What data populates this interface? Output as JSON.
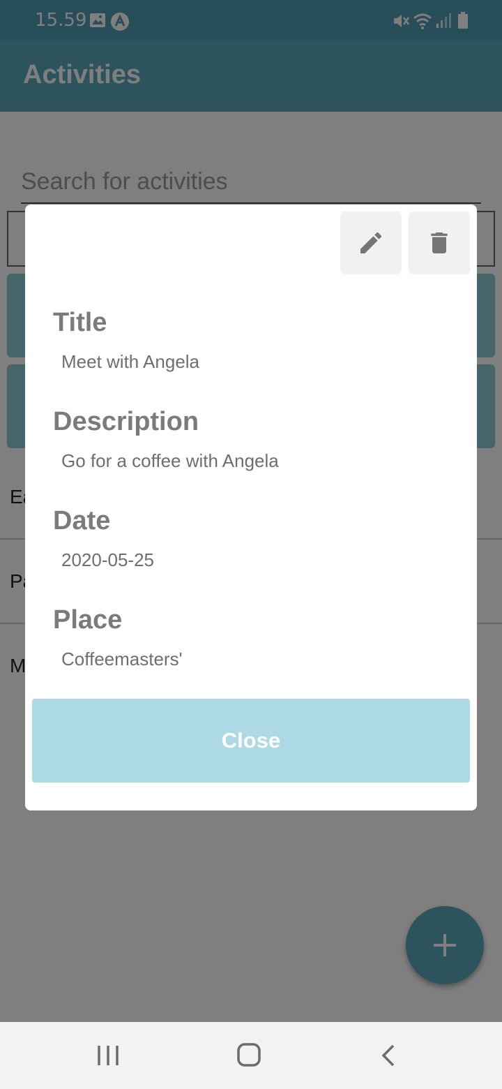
{
  "status_bar": {
    "time": "15.59",
    "icons": [
      "image-icon",
      "app-notification-icon",
      "mute-icon",
      "wifi-icon",
      "signal-icon",
      "battery-icon"
    ]
  },
  "app_bar": {
    "title": "Activities"
  },
  "search": {
    "placeholder": "Search for activities"
  },
  "list": {
    "items": [
      "Ea",
      "Pa",
      "M"
    ]
  },
  "modal": {
    "actions": {
      "edit_icon": "pencil-icon",
      "delete_icon": "trash-icon"
    },
    "fields": [
      {
        "label": "Title",
        "value": "Meet with Angela"
      },
      {
        "label": "Description",
        "value": "Go for a coffee with Angela"
      },
      {
        "label": "Date",
        "value": "2020-05-25"
      },
      {
        "label": "Place",
        "value": "Coffeemasters'"
      }
    ],
    "close_label": "Close"
  },
  "fab": {
    "icon": "plus-icon"
  },
  "nav_bar": {
    "icons": [
      "recent-apps-icon",
      "home-icon",
      "back-icon"
    ]
  },
  "colors": {
    "primary": "#5aa8bb",
    "status_bar": "#519fb3",
    "card": "#8fc9d7",
    "close_button": "#add8e6",
    "label_text": "#7b7b7b"
  }
}
